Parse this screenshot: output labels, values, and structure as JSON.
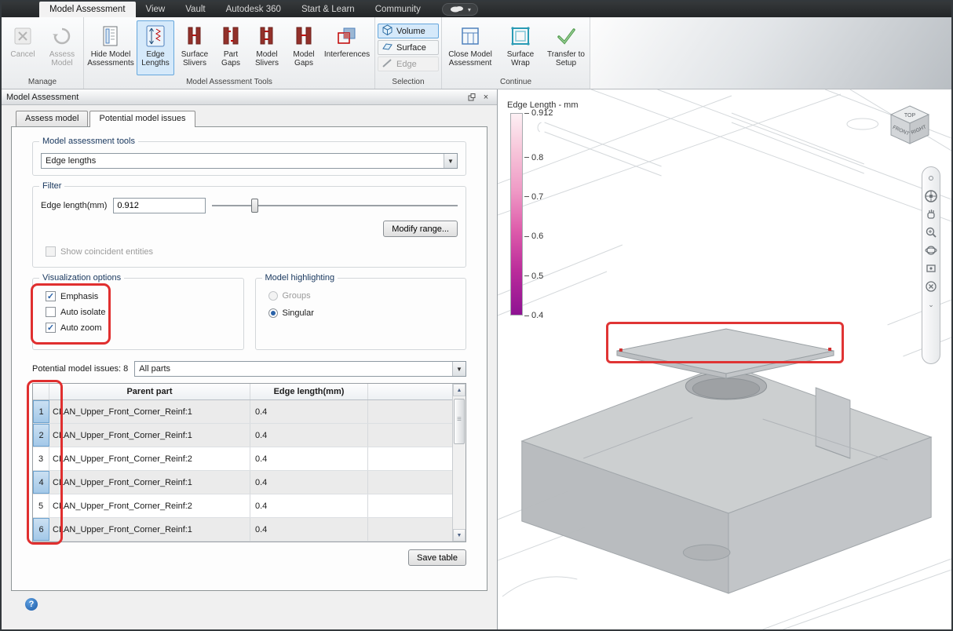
{
  "titlebar": {
    "tabs": [
      {
        "label": "Model Assessment"
      },
      {
        "label": "View"
      },
      {
        "label": "Vault"
      },
      {
        "label": "Autodesk 360"
      },
      {
        "label": "Start & Learn"
      },
      {
        "label": "Community"
      }
    ]
  },
  "ribbon": {
    "manage": {
      "label": "Manage",
      "cancel": "Cancel",
      "assess": "Assess Model"
    },
    "tools": {
      "label": "Model Assessment Tools",
      "hide": "Hide Model Assessments",
      "edge_lengths": "Edge Lengths",
      "surface_slivers": "Surface Slivers",
      "part_gaps": "Part Gaps",
      "model_slivers": "Model Slivers",
      "model_gaps": "Model Gaps",
      "interferences": "Interferences"
    },
    "selection": {
      "label": "Selection",
      "volume": "Volume",
      "surface": "Surface",
      "edge": "Edge"
    },
    "continue_group": {
      "label": "Continue",
      "close": "Close Model Assessment",
      "wrap": "Surface Wrap",
      "transfer": "Transfer to Setup"
    }
  },
  "panel": {
    "title": "Model Assessment",
    "tabs": {
      "assess": "Assess model",
      "issues": "Potential model issues"
    },
    "tools_group": {
      "label": "Model assessment tools",
      "combo_value": "Edge lengths"
    },
    "filter": {
      "label": "Filter",
      "edge_length_label": "Edge length(mm)",
      "edge_length_value": "0.912",
      "modify_range": "Modify range...",
      "coincident": "Show coincident entities"
    },
    "visualization": {
      "label": "Visualization options",
      "emphasis": "Emphasis",
      "auto_isolate": "Auto isolate",
      "auto_zoom": "Auto zoom"
    },
    "highlighting": {
      "label": "Model highlighting",
      "groups": "Groups",
      "singular": "Singular"
    },
    "issues_label": "Potential model issues: 8",
    "issues_combo": "All parts",
    "table": {
      "col_parent": "Parent part",
      "col_length": "Edge length(mm)",
      "rows": [
        {
          "num": "1",
          "part": "CLAN_Upper_Front_Corner_Reinf:1",
          "length": "0.4",
          "selected": true
        },
        {
          "num": "2",
          "part": "CLAN_Upper_Front_Corner_Reinf:1",
          "length": "0.4",
          "selected": true
        },
        {
          "num": "3",
          "part": "CLAN_Upper_Front_Corner_Reinf:2",
          "length": "0.4",
          "selected": false
        },
        {
          "num": "4",
          "part": "CLAN_Upper_Front_Corner_Reinf:1",
          "length": "0.4",
          "selected": true
        },
        {
          "num": "5",
          "part": "CLAN_Upper_Front_Corner_Reinf:2",
          "length": "0.4",
          "selected": false
        },
        {
          "num": "6",
          "part": "CLAN_Upper_Front_Corner_Reinf:1",
          "length": "0.4",
          "selected": true
        }
      ]
    },
    "save_table": "Save table"
  },
  "viewport": {
    "legend": {
      "title": "Edge Length - mm",
      "ticks": [
        "0.912",
        "0.8",
        "0.7",
        "0.6",
        "0.5",
        "0.4"
      ],
      "color_top": "#fdf0f4",
      "color_bottom": "#8e1292"
    },
    "viewcube": {
      "top": "TOP",
      "front": "FRONT",
      "right": "RIGHT"
    }
  },
  "colors": {
    "annotation": "#e02f2f",
    "highlight_bg": "#d5e9fa",
    "highlight_border": "#66a7dc"
  }
}
